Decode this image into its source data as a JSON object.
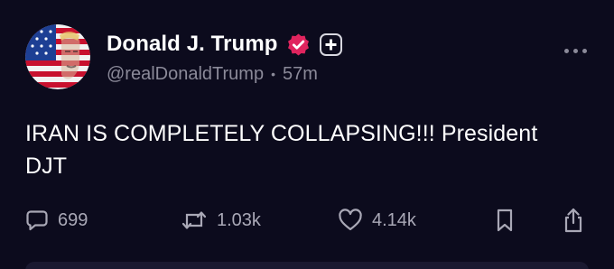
{
  "post": {
    "author": {
      "display_name": "Donald J. Trump",
      "handle": "@realDonaldTrump",
      "separator": "•",
      "time": "57m",
      "avatar_icon": "flag-portrait-avatar",
      "verified_icon": "verified-badge-icon",
      "verified_color": "#e0245e",
      "plus_icon": "plus-badge-icon"
    },
    "text": "IRAN IS COMPLETELY COLLAPSING!!! President DJT",
    "more_icon": "more-options-icon",
    "actions": {
      "replies": {
        "icon": "reply-icon",
        "count": "699"
      },
      "reposts": {
        "icon": "repost-icon",
        "count": "1.03k"
      },
      "likes": {
        "icon": "heart-icon",
        "count": "4.14k"
      },
      "bookmark": {
        "icon": "bookmark-icon"
      },
      "share": {
        "icon": "share-icon"
      }
    }
  },
  "theme": {
    "background": "#0c0b1d",
    "muted_text": "#8b8a99"
  }
}
